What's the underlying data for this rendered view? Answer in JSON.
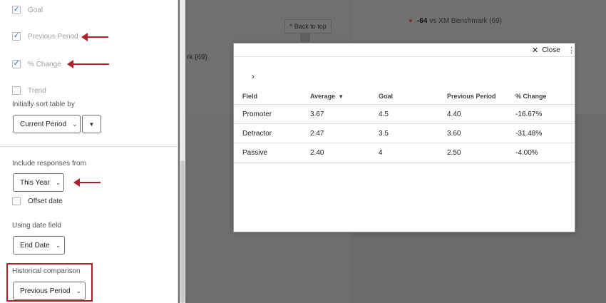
{
  "panel": {
    "checkboxes": [
      {
        "label": "Goal",
        "checked": true
      },
      {
        "label": "Previous Period",
        "checked": true
      },
      {
        "label": "% Change",
        "checked": true
      },
      {
        "label": "Trend",
        "checked": false
      }
    ],
    "sort_label": "Initially sort table by",
    "sort_value": "Current Period",
    "include_label": "Include responses from",
    "include_value": "This Year",
    "offset_label": "Offset date",
    "offset_checked": false,
    "date_field_label": "Using date field",
    "date_field_value": "End Date",
    "historical_label": "Historical comparison",
    "historical_value": "Previous Period"
  },
  "background": {
    "back_to_top": "^ Back to top",
    "benchmark_value": "-64",
    "benchmark_text": "vs XM Benchmark (69)",
    "partial_text": "rk (69)"
  },
  "modal": {
    "close_label": "Close",
    "table": {
      "headers": [
        "Field",
        "Average",
        "Goal",
        "Previous Period",
        "% Change"
      ],
      "rows": [
        [
          "Promoter",
          "3.67",
          "4.5",
          "4.40",
          "-16.67%"
        ],
        [
          "Detractor",
          "2.47",
          "3.5",
          "3.60",
          "-31.48%"
        ],
        [
          "Passive",
          "2.40",
          "4",
          "2.50",
          "-4.00%"
        ]
      ]
    }
  },
  "colors": {
    "annotation_red": "#b3202b",
    "checkbox_blue": "#1d6ad6",
    "overlay_gray": "#6b6b6b"
  },
  "icons": {
    "check": "check-icon",
    "chevron": "chevron-down-icon",
    "close": "close-icon",
    "kebab": "kebab-menu-icon",
    "sort": "sort-desc-icon",
    "expand": "chevron-right-icon"
  }
}
